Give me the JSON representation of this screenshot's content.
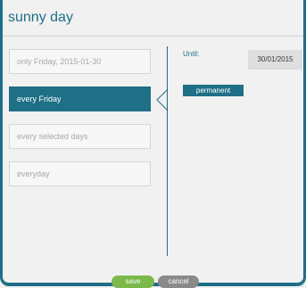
{
  "dialog": {
    "title": "sunny day"
  },
  "options": [
    {
      "label": "only Friday, 2015-01-30"
    },
    {
      "label": "every Friday"
    },
    {
      "label": "every selected days"
    },
    {
      "label": "everyday"
    }
  ],
  "until": {
    "label": "Until:",
    "value": "30/01/2015"
  },
  "permanent_label": "permanent",
  "buttons": {
    "save": "save",
    "cancel": "cancel"
  },
  "colors": {
    "accent": "#1f6f86",
    "save": "#7bb94a",
    "cancel": "#8a8a8a"
  }
}
